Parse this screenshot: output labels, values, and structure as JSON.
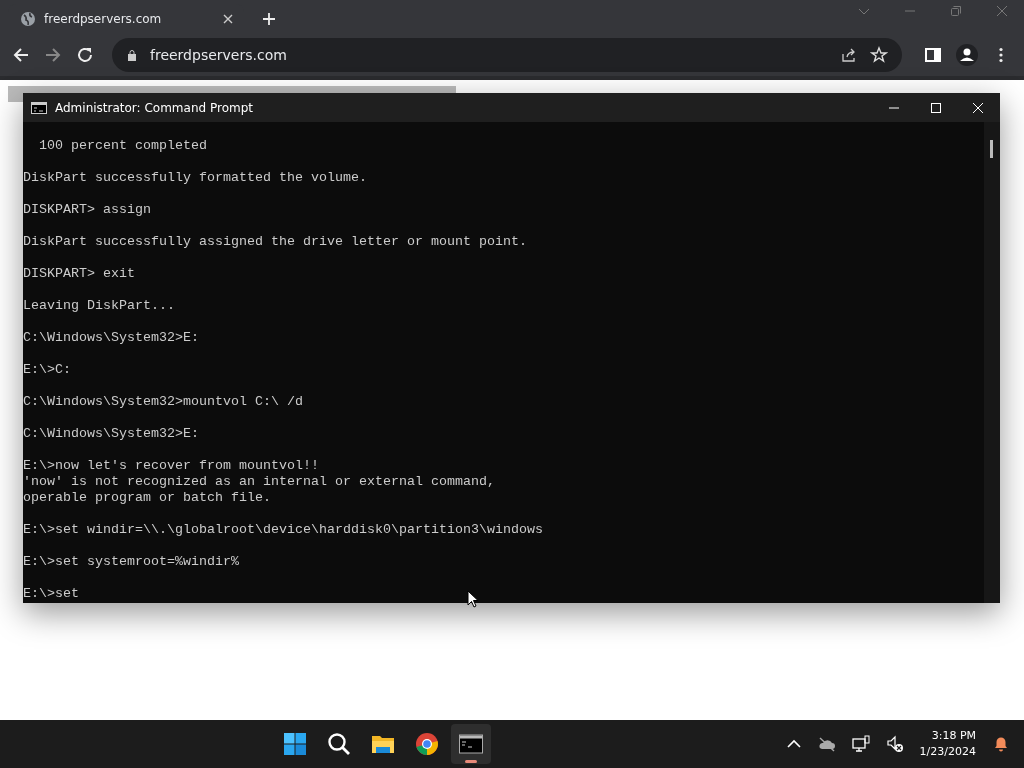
{
  "browser": {
    "tab": {
      "title": "freerdpservers.com",
      "selected": true
    },
    "address": "freerdpservers.com"
  },
  "console_window": {
    "title": "Administrator: Command Prompt",
    "blocks": [
      [
        "  100 percent completed"
      ],
      [
        "DiskPart successfully formatted the volume."
      ],
      [
        "DISKPART> assign"
      ],
      [
        "DiskPart successfully assigned the drive letter or mount point."
      ],
      [
        "DISKPART> exit"
      ],
      [
        "Leaving DiskPart..."
      ],
      [
        "C:\\Windows\\System32>E:"
      ],
      [
        "E:\\>C:"
      ],
      [
        "C:\\Windows\\System32>mountvol C:\\ /d"
      ],
      [
        "C:\\Windows\\System32>E:"
      ],
      [
        "E:\\>now let's recover from mountvol!!",
        "'now' is not recognized as an internal or external command,",
        "operable program or batch file."
      ],
      [
        "E:\\>set windir=\\\\.\\globalroot\\device\\harddisk0\\partition3\\windows"
      ],
      [
        "E:\\>set systemroot=%windir%"
      ],
      [
        "E:\\>set"
      ]
    ]
  },
  "taskbar": {
    "apps": [
      {
        "kind": "start",
        "active": false
      },
      {
        "kind": "search",
        "active": false
      },
      {
        "kind": "files",
        "active": false
      },
      {
        "kind": "browser",
        "active": false
      },
      {
        "kind": "terminal",
        "active": true
      }
    ],
    "time": "3:18 PM",
    "date": "1/23/2024"
  }
}
